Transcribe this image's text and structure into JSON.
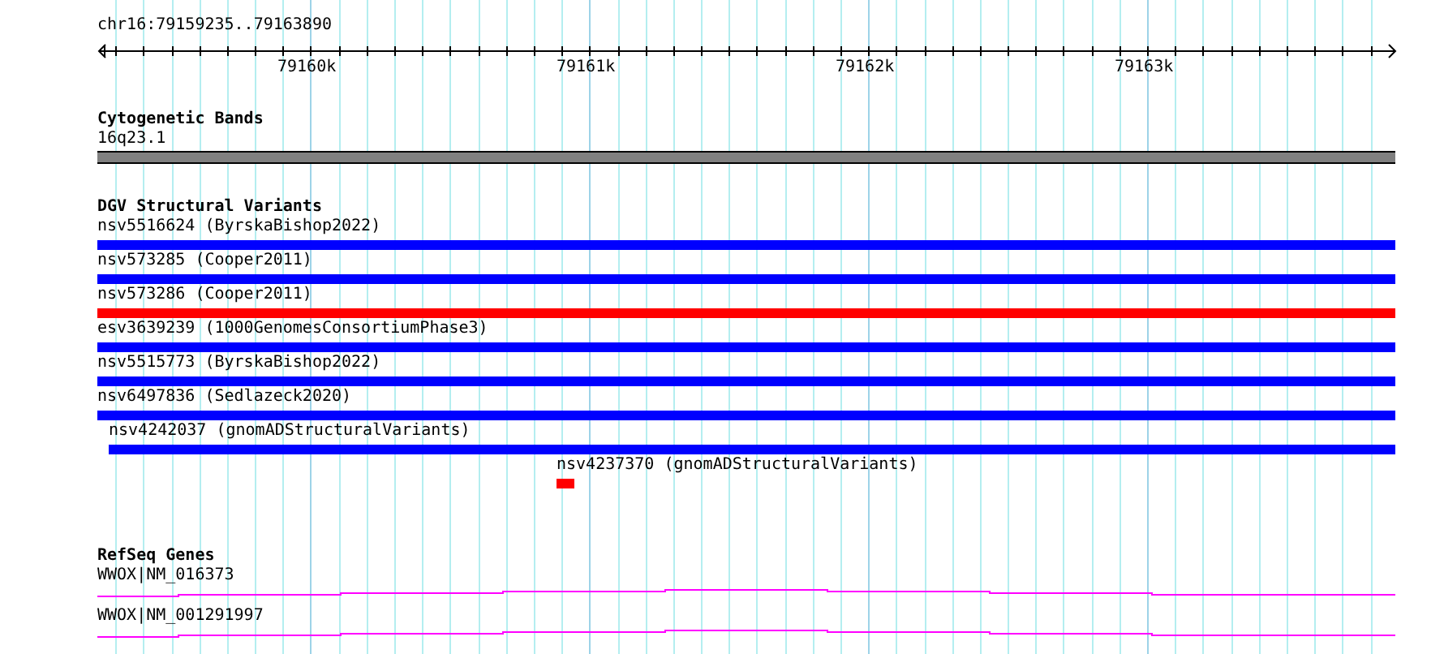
{
  "location": "chr16:79159235..79163890",
  "ruler": {
    "labels": [
      "79160k",
      "79161k",
      "79162k",
      "79163k"
    ]
  },
  "tracks": [
    {
      "kind": "cytoband",
      "title": "Cytogenetic Bands",
      "features": [
        {
          "label": "16q23.1"
        }
      ]
    },
    {
      "kind": "variants",
      "title": "DGV Structural Variants",
      "features": [
        {
          "label": "nsv5516624 (ByrskaBishop2022)",
          "color": "#0000ff",
          "kind": "full"
        },
        {
          "label": "nsv573285 (Cooper2011)",
          "color": "#0000ff",
          "kind": "full"
        },
        {
          "label": "nsv573286 (Cooper2011)",
          "color": "#ff0000",
          "kind": "full"
        },
        {
          "label": "esv3639239 (1000GenomesConsortiumPhase3)",
          "color": "#0000ff",
          "kind": "full"
        },
        {
          "label": "nsv5515773 (ByrskaBishop2022)",
          "color": "#0000ff",
          "kind": "full"
        },
        {
          "label": "nsv6497836 (Sedlazeck2020)",
          "color": "#0000ff",
          "kind": "full"
        },
        {
          "label": "nsv4242037 (gnomADStructuralVariants)",
          "color": "#0000ff",
          "kind": "inset"
        },
        {
          "label": "nsv4237370 (gnomADStructuralVariants)",
          "color": "#ff0000",
          "kind": "short"
        }
      ]
    },
    {
      "kind": "genes",
      "title": "RefSeq Genes",
      "features": [
        {
          "label": "WWOX|NM_016373"
        },
        {
          "label": "WWOX|NM_001291997"
        }
      ]
    }
  ]
}
